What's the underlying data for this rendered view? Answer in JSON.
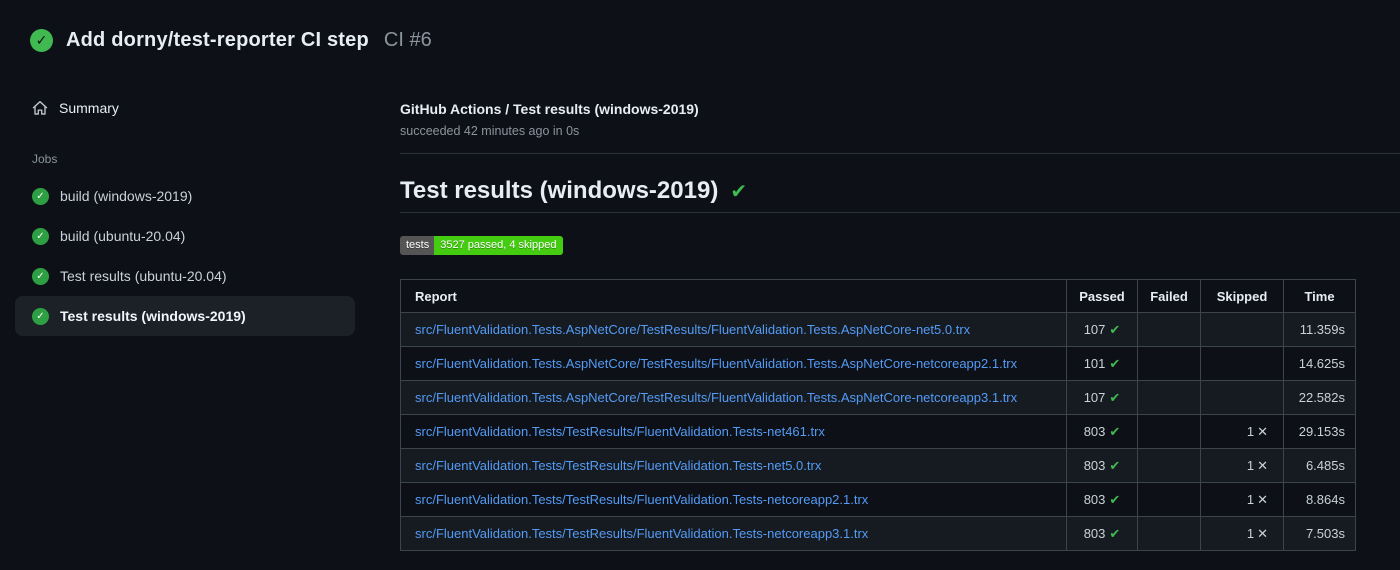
{
  "header": {
    "title": "Add dorny/test-reporter CI step",
    "run_number": "CI #6"
  },
  "sidebar": {
    "summary_label": "Summary",
    "jobs_label": "Jobs",
    "jobs": [
      {
        "label": "build (windows-2019)",
        "selected": false
      },
      {
        "label": "build (ubuntu-20.04)",
        "selected": false
      },
      {
        "label": "Test results (ubuntu-20.04)",
        "selected": false
      },
      {
        "label": "Test results (windows-2019)",
        "selected": true
      }
    ]
  },
  "main": {
    "check_title": "GitHub Actions / Test results (windows-2019)",
    "check_status": "succeeded 42 minutes ago in 0s",
    "heading": "Test results (windows-2019)",
    "badge": {
      "label": "tests",
      "value": "3527 passed, 4 skipped",
      "label_bg": "#555555",
      "value_bg": "#44cc11"
    },
    "table": {
      "columns": [
        "Report",
        "Passed",
        "Failed",
        "Skipped",
        "Time"
      ],
      "rows": [
        {
          "report": "src/FluentValidation.Tests.AspNetCore/TestResults/FluentValidation.Tests.AspNetCore-net5.0.trx",
          "passed": "107",
          "failed": "",
          "skipped": "",
          "time": "11.359s"
        },
        {
          "report": "src/FluentValidation.Tests.AspNetCore/TestResults/FluentValidation.Tests.AspNetCore-netcoreapp2.1.trx",
          "passed": "101",
          "failed": "",
          "skipped": "",
          "time": "14.625s"
        },
        {
          "report": "src/FluentValidation.Tests.AspNetCore/TestResults/FluentValidation.Tests.AspNetCore-netcoreapp3.1.trx",
          "passed": "107",
          "failed": "",
          "skipped": "",
          "time": "22.582s"
        },
        {
          "report": "src/FluentValidation.Tests/TestResults/FluentValidation.Tests-net461.trx",
          "passed": "803",
          "failed": "",
          "skipped": "1",
          "time": "29.153s"
        },
        {
          "report": "src/FluentValidation.Tests/TestResults/FluentValidation.Tests-net5.0.trx",
          "passed": "803",
          "failed": "",
          "skipped": "1",
          "time": "6.485s"
        },
        {
          "report": "src/FluentValidation.Tests/TestResults/FluentValidation.Tests-netcoreapp2.1.trx",
          "passed": "803",
          "failed": "",
          "skipped": "1",
          "time": "8.864s"
        },
        {
          "report": "src/FluentValidation.Tests/TestResults/FluentValidation.Tests-netcoreapp3.1.trx",
          "passed": "803",
          "failed": "",
          "skipped": "1",
          "time": "7.503s"
        }
      ]
    }
  },
  "icons": {
    "status_check": "✓",
    "job_check": "✓",
    "heading_check": "✔",
    "passed_check": "✔",
    "skipped_x": "✕"
  },
  "colors": {
    "success_green": "#3fb950",
    "link_blue": "#539bf5"
  }
}
